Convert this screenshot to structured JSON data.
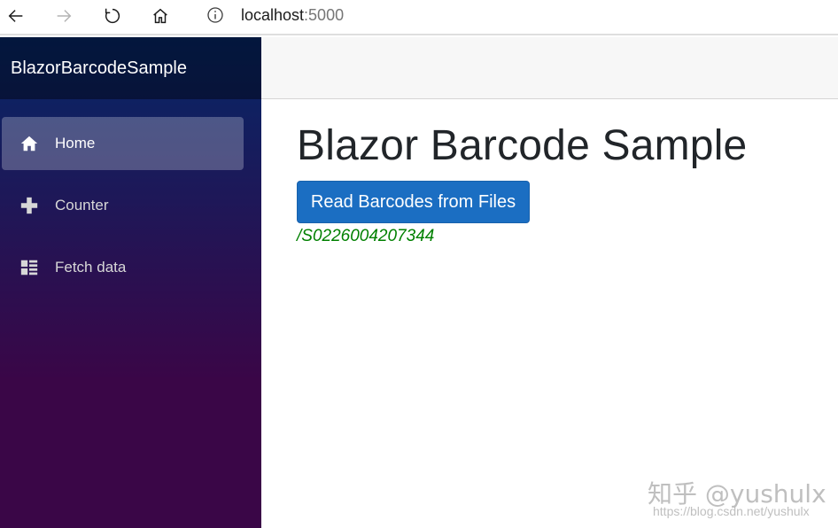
{
  "browser": {
    "url_host": "localhost",
    "url_port": ":5000",
    "icons": [
      "back-arrow-icon",
      "forward-arrow-icon",
      "refresh-icon",
      "home-icon",
      "info-icon"
    ]
  },
  "sidebar": {
    "brand": "BlazorBarcodeSample",
    "items": [
      {
        "label": "Home",
        "icon": "home-icon",
        "active": true
      },
      {
        "label": "Counter",
        "icon": "plus-icon",
        "active": false
      },
      {
        "label": "Fetch data",
        "icon": "list-icon",
        "active": false
      }
    ]
  },
  "main": {
    "title": "Blazor Barcode Sample",
    "button_label": "Read Barcodes from Files",
    "result_text": "/S0226004207344"
  },
  "watermark": {
    "main": "知乎 @yushulx",
    "url": "https://blog.csdn.net/yushulx"
  },
  "colors": {
    "primary_button": "#1b6ec2",
    "result_green": "#008000",
    "sidebar_top": "#052767",
    "sidebar_bottom": "#3a0647"
  }
}
